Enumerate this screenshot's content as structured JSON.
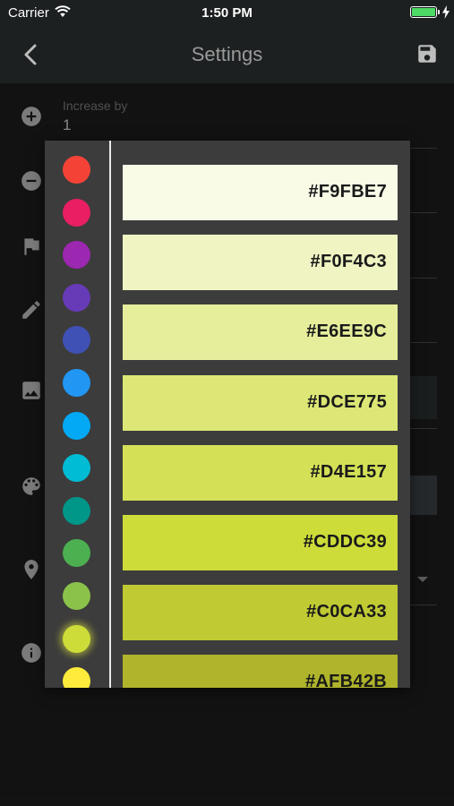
{
  "status_bar": {
    "carrier": "Carrier",
    "time": "1:50 PM",
    "battery_color": "#4cd964"
  },
  "nav": {
    "title": "Settings"
  },
  "settings": {
    "increase_label": "Increase by",
    "increase_value": "1"
  },
  "row_icons": [
    "plus-circle-icon",
    "minus-circle-icon",
    "flag-icon",
    "pencil-icon",
    "image-icon",
    "palette-icon",
    "location-pin-icon",
    "info-icon"
  ],
  "picker": {
    "hues": [
      {
        "name": "red",
        "color": "#F44336"
      },
      {
        "name": "pink",
        "color": "#E91E63"
      },
      {
        "name": "purple",
        "color": "#9C27B0"
      },
      {
        "name": "deep-purple",
        "color": "#673AB7"
      },
      {
        "name": "indigo",
        "color": "#3F51B5"
      },
      {
        "name": "blue",
        "color": "#2196F3"
      },
      {
        "name": "light-blue",
        "color": "#03A9F4"
      },
      {
        "name": "cyan",
        "color": "#00BCD4"
      },
      {
        "name": "teal",
        "color": "#009688"
      },
      {
        "name": "green",
        "color": "#4CAF50"
      },
      {
        "name": "light-green",
        "color": "#8BC34A"
      },
      {
        "name": "lime",
        "color": "#CDDC39",
        "selected": true
      },
      {
        "name": "yellow",
        "color": "#FFEB3B"
      }
    ],
    "shades": [
      {
        "label": "#F9FBE7",
        "color": "#F9FBE7"
      },
      {
        "label": "#F0F4C3",
        "color": "#F0F4C3"
      },
      {
        "label": "#E6EE9C",
        "color": "#E6EE9C"
      },
      {
        "label": "#DCE775",
        "color": "#DCE775"
      },
      {
        "label": "#D4E157",
        "color": "#D4E157"
      },
      {
        "label": "#CDDC39",
        "color": "#CDDC39"
      },
      {
        "label": "#C0CA33",
        "color": "#C0CA33"
      },
      {
        "label": "#AFB42B",
        "color": "#AFB42B"
      }
    ]
  }
}
